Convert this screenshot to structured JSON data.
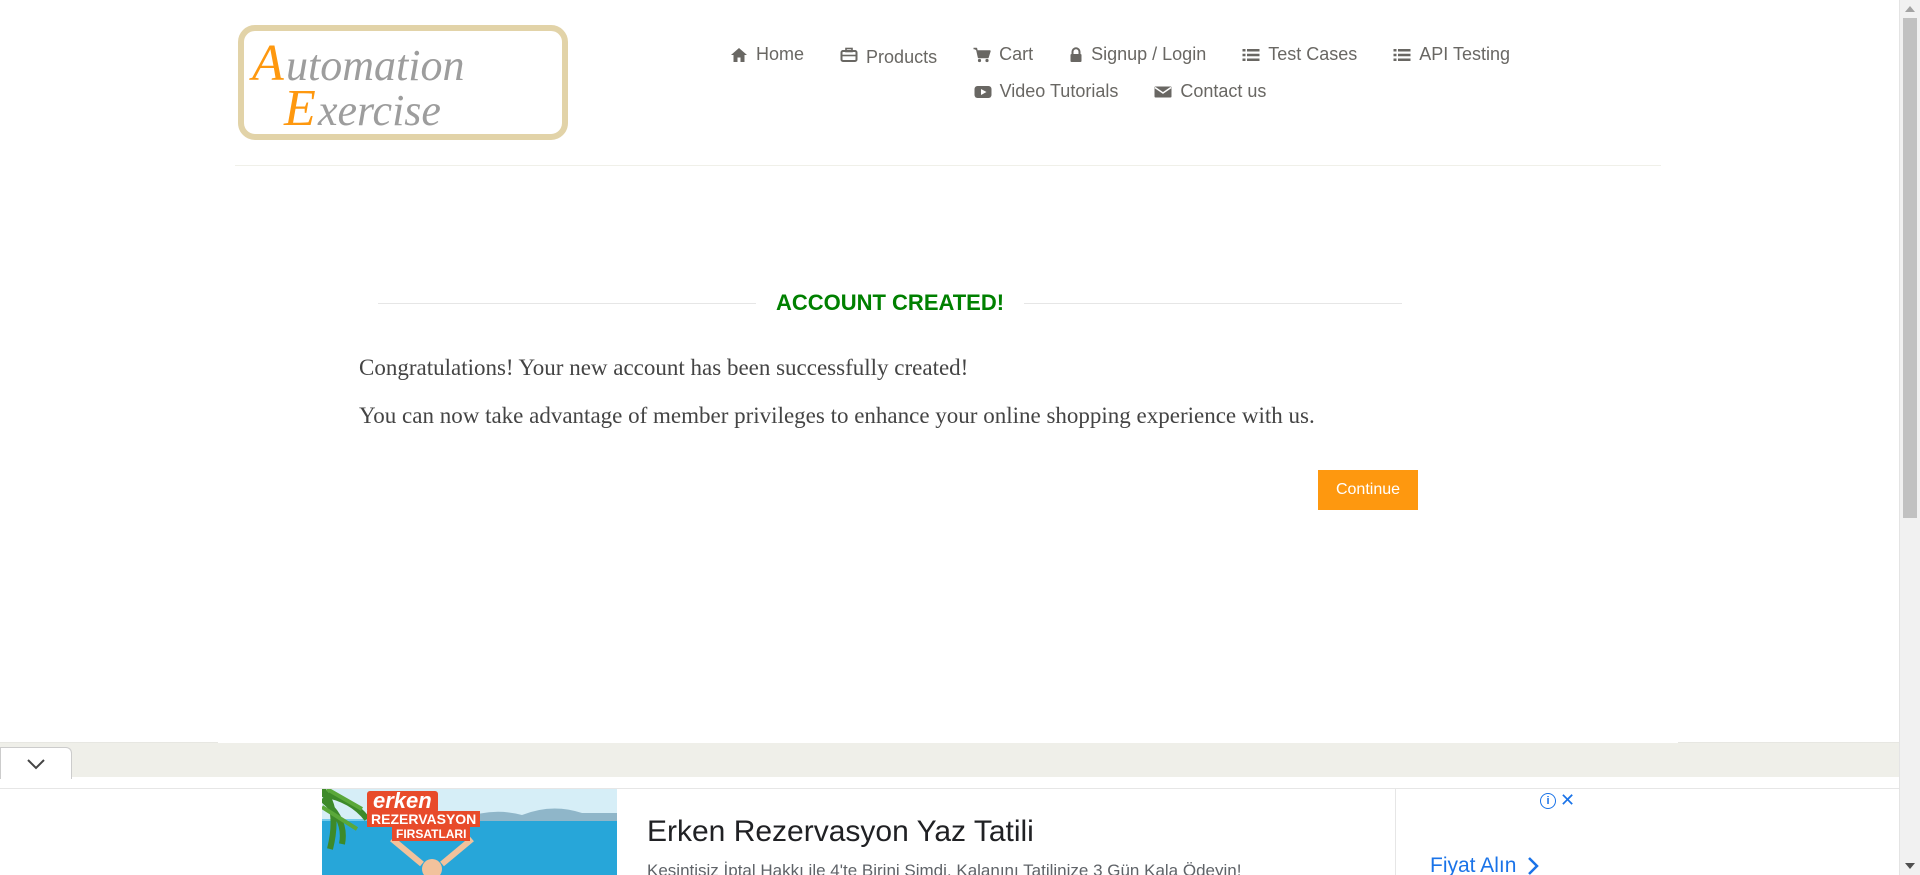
{
  "logo": {
    "line1": "Automation",
    "line2": "Exercise"
  },
  "nav": {
    "items": [
      {
        "label": "Home",
        "icon": "home-icon"
      },
      {
        "label": "Products",
        "icon": "briefcase-icon"
      },
      {
        "label": "Cart",
        "icon": "cart-icon"
      },
      {
        "label": "Signup / Login",
        "icon": "lock-icon"
      },
      {
        "label": "Test Cases",
        "icon": "list-icon"
      },
      {
        "label": "API Testing",
        "icon": "list-icon"
      },
      {
        "label": "Video Tutorials",
        "icon": "youtube-play-icon"
      },
      {
        "label": "Contact us",
        "icon": "envelope-icon"
      }
    ]
  },
  "main": {
    "title": "ACCOUNT CREATED!",
    "message1": "Congratulations! Your new account has been successfully created!",
    "message2": "You can now take advantage of member privileges to enhance your online shopping experience with us.",
    "continue_label": "Continue"
  },
  "ad": {
    "brand": "erken",
    "sub": "REZERVASYON",
    "sub2": "FIRSATLARI",
    "headline": "Erken Rezervasyon Yaz Tatili",
    "description": "Kesintisiz İptal Hakkı ile 4'te Birini Şimdi, Kalanını Tatilinize 3 Gün Kala Ödeyin!",
    "cta": "Fiyat Alın",
    "info_glyph": "i",
    "close_glyph": "✕"
  },
  "colors": {
    "title_green": "#008000",
    "button_orange": "#fe980f",
    "logo_orange": "#fe980f",
    "nav_text": "#696763",
    "ad_blue": "#1a73e8"
  }
}
